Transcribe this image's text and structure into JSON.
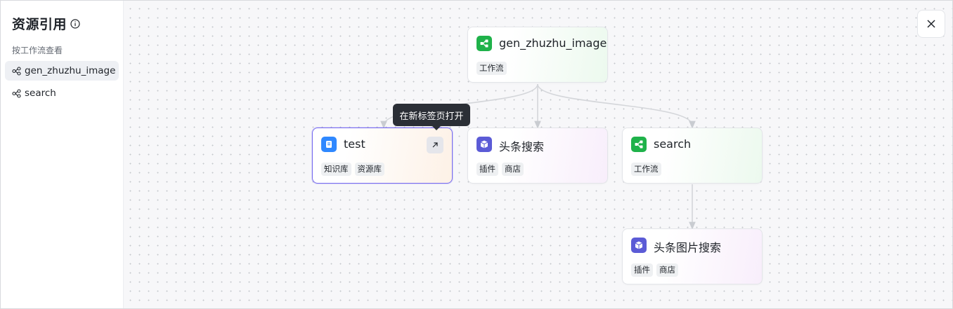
{
  "sidebar": {
    "title": "资源引用",
    "subtitle": "按工作流查看",
    "items": [
      {
        "label": "gen_zhuzhu_image",
        "active": true
      },
      {
        "label": "search",
        "active": false
      }
    ]
  },
  "tooltip": "在新标签页打开",
  "nodes": {
    "root": {
      "title": "gen_zhuzhu_image",
      "tags": [
        "工作流"
      ]
    },
    "test": {
      "title": "test",
      "tags": [
        "知识库",
        "资源库"
      ]
    },
    "toutiao_search": {
      "title": "头条搜索",
      "tags": [
        "插件",
        "商店"
      ]
    },
    "search": {
      "title": "search",
      "tags": [
        "工作流"
      ]
    },
    "toutiao_image_search": {
      "title": "头条图片搜索",
      "tags": [
        "插件",
        "商店"
      ]
    }
  },
  "colors": {
    "workflow_icon": "#1fb24a",
    "plugin_icon": "#5b5bd6",
    "knowledge_icon": "#2f88ff",
    "selected_border": "#7a6ff0"
  },
  "icons": {
    "info": "info-circle-icon",
    "workflow": "workflow-icon",
    "plugin": "cube-icon",
    "knowledge": "book-icon",
    "open": "arrow-up-right-icon",
    "close": "close-icon"
  }
}
